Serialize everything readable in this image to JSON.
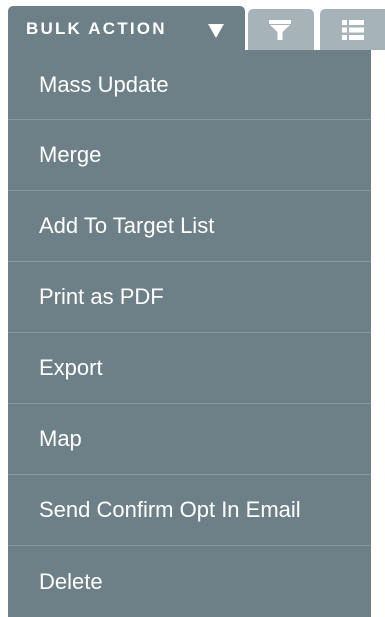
{
  "toolbar": {
    "bulk_action_label": "BULK ACTION",
    "caret_icon": "caret-down-icon",
    "filter_icon": "filter-icon",
    "list_view_icon": "list-view-icon"
  },
  "menu": {
    "items": [
      {
        "label": "Mass Update"
      },
      {
        "label": "Merge"
      },
      {
        "label": "Add To Target List"
      },
      {
        "label": "Print as PDF"
      },
      {
        "label": "Export"
      },
      {
        "label": "Map"
      },
      {
        "label": "Send Confirm Opt In Email"
      },
      {
        "label": "Delete"
      }
    ]
  },
  "colors": {
    "menu_background": "#6e8087",
    "secondary_tab": "#a6b4ba",
    "text": "#ffffff"
  }
}
